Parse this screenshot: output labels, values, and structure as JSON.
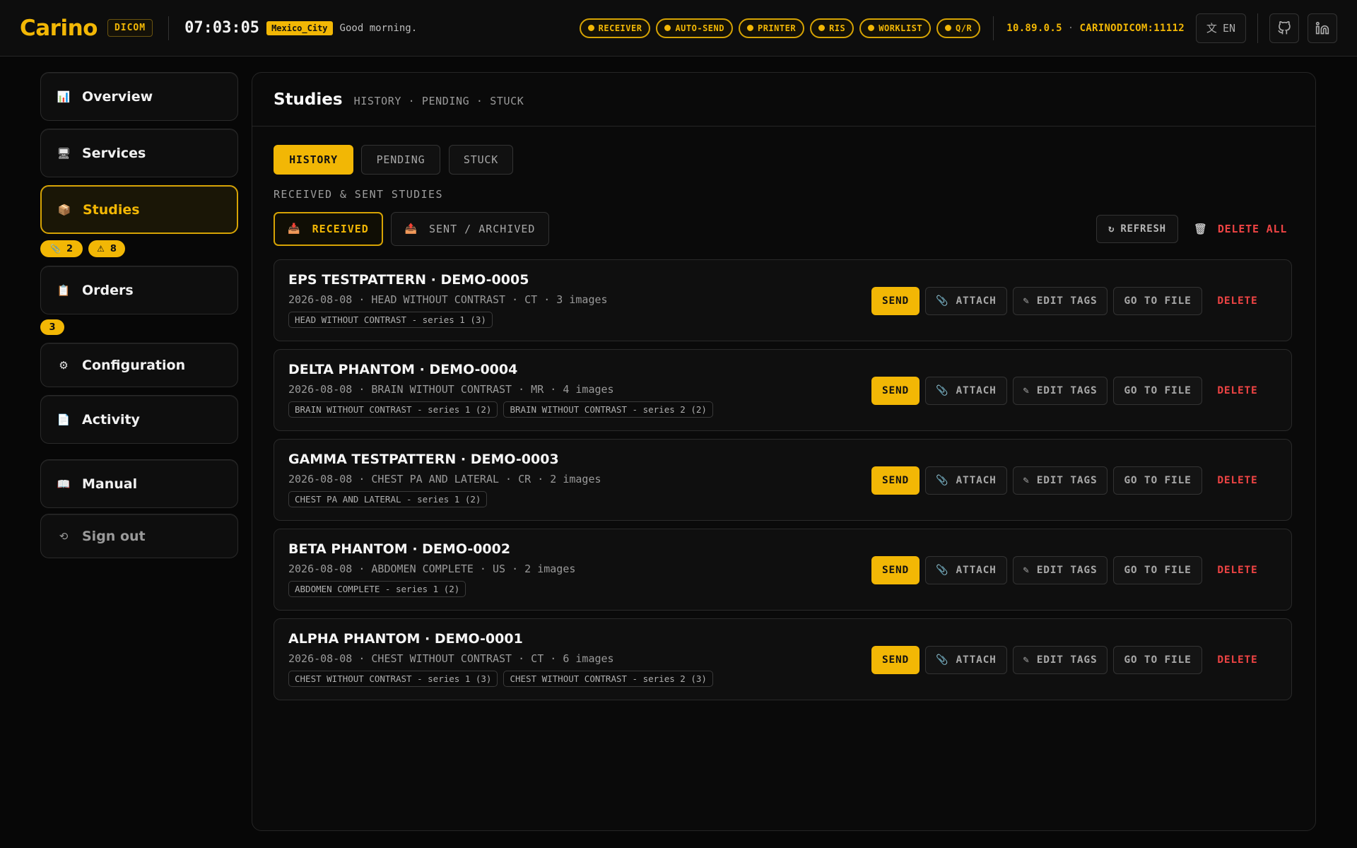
{
  "header": {
    "logo": "Carino",
    "tag": "DICOM",
    "clock": "07:03:05",
    "timezone": "Mexico_City",
    "greeting": "Good morning.",
    "status_pills": [
      "RECEIVER",
      "AUTO-SEND",
      "PRINTER",
      "RIS",
      "WORKLIST",
      "Q/R"
    ],
    "ip": "10.89.0.5",
    "ae": "CARINODICOM:11112",
    "lang": "EN",
    "accent_color": "#f2b705"
  },
  "sidebar": {
    "items": [
      {
        "label": "Overview",
        "icon": "chart-icon"
      },
      {
        "label": "Services",
        "icon": "monitor-icon"
      },
      {
        "label": "Studies",
        "icon": "box-icon"
      },
      {
        "label": "Orders",
        "icon": "clipboard-icon"
      },
      {
        "label": "Configuration",
        "icon": "gear-icon"
      },
      {
        "label": "Activity",
        "icon": "document-icon"
      },
      {
        "label": "Manual",
        "icon": "book-icon"
      },
      {
        "label": "Sign out",
        "icon": "power-icon"
      }
    ],
    "studies_badges": [
      "2",
      "8"
    ],
    "orders_badge": "3"
  },
  "main": {
    "title": "Studies",
    "subtitle": "HISTORY · PENDING · STUCK",
    "tabs": [
      "HISTORY",
      "PENDING",
      "STUCK"
    ],
    "section_label": "RECEIVED & SENT STUDIES",
    "subtabs": [
      "RECEIVED",
      "SENT / ARCHIVED"
    ],
    "refresh_label": "REFRESH",
    "delete_all_label": "DELETE ALL",
    "action_labels": {
      "send": "SEND",
      "attach": "ATTACH",
      "edit_tags": "EDIT TAGS",
      "go_to_file": "GO TO FILE",
      "delete": "DELETE"
    },
    "studies": [
      {
        "title": "EPS TESTPATTERN · DEMO-0005",
        "meta": "2026-08-08 · HEAD WITHOUT CONTRAST · CT · 3 images",
        "series": [
          "HEAD WITHOUT CONTRAST - series 1 (3)"
        ]
      },
      {
        "title": "DELTA PHANTOM · DEMO-0004",
        "meta": "2026-08-08 · BRAIN WITHOUT CONTRAST · MR · 4 images",
        "series": [
          "BRAIN WITHOUT CONTRAST - series 1 (2)",
          "BRAIN WITHOUT CONTRAST - series 2 (2)"
        ]
      },
      {
        "title": "GAMMA TESTPATTERN · DEMO-0003",
        "meta": "2026-08-08 · CHEST PA AND LATERAL · CR · 2 images",
        "series": [
          "CHEST PA AND LATERAL - series 1 (2)"
        ]
      },
      {
        "title": "BETA PHANTOM · DEMO-0002",
        "meta": "2026-08-08 · ABDOMEN COMPLETE · US · 2 images",
        "series": [
          "ABDOMEN COMPLETE - series 1 (2)"
        ]
      },
      {
        "title": "ALPHA PHANTOM · DEMO-0001",
        "meta": "2026-08-08 · CHEST WITHOUT CONTRAST · CT · 6 images",
        "series": [
          "CHEST WITHOUT CONTRAST - series 1 (3)",
          "CHEST WITHOUT CONTRAST - series 2 (3)"
        ]
      }
    ]
  }
}
